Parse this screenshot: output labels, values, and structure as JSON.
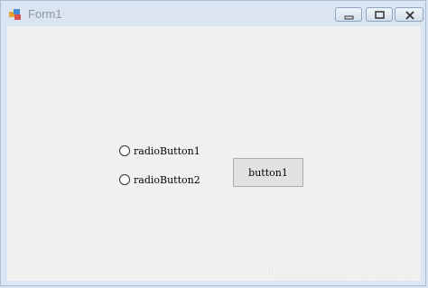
{
  "window": {
    "title": "Form1",
    "icons": {
      "app": "winforms-app-icon",
      "minimize": "minimize-icon",
      "maximize": "maximize-icon",
      "close": "close-icon"
    }
  },
  "form": {
    "radio_buttons": [
      {
        "label": "radioButton1",
        "checked": false
      },
      {
        "label": "radioButton2",
        "checked": false
      }
    ],
    "button": {
      "label": "button1"
    }
  },
  "watermark": {
    "text": "https://blog.csdn.net/l_TenKai"
  },
  "colors": {
    "frame": "#dbe6f2",
    "client": "#f0f0f0",
    "button_face": "#e1e1e1",
    "button_border": "#adadad"
  }
}
